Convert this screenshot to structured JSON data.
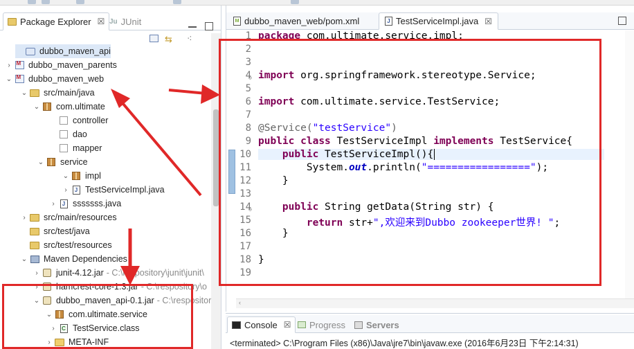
{
  "left_panel": {
    "tabs": [
      {
        "label": "Package Explorer",
        "close": "☒",
        "icon": "package-explorer-icon"
      },
      {
        "label": "JUnit",
        "icon": "junit-icon"
      }
    ],
    "tree": [
      {
        "label": "dubbo_maven_api",
        "icon": "project-icon",
        "toggle": ""
      },
      {
        "label": "dubbo_maven_parents",
        "icon": "maven-project-icon",
        "toggle": "›"
      },
      {
        "label": "dubbo_maven_web",
        "icon": "maven-project-icon",
        "toggle": "⌄"
      },
      {
        "label": "src/main/java",
        "icon": "source-folder-icon",
        "toggle": "⌄"
      },
      {
        "label": "com.ultimate",
        "icon": "package-icon",
        "toggle": "⌄"
      },
      {
        "label": "controller",
        "icon": "empty-package-icon",
        "toggle": ""
      },
      {
        "label": "dao",
        "icon": "empty-package-icon",
        "toggle": ""
      },
      {
        "label": "mapper",
        "icon": "empty-package-icon",
        "toggle": ""
      },
      {
        "label": "service",
        "icon": "package-icon",
        "toggle": "⌄"
      },
      {
        "label": "impl",
        "icon": "package-icon",
        "toggle": "⌄"
      },
      {
        "label": "TestServiceImpl.java",
        "icon": "java-file-icon",
        "toggle": "›"
      },
      {
        "label": "sssssss.java",
        "icon": "java-file-icon",
        "toggle": "›"
      },
      {
        "label": "src/main/resources",
        "icon": "source-folder-icon",
        "toggle": "›"
      },
      {
        "label": "src/test/java",
        "icon": "source-folder-icon",
        "toggle": ""
      },
      {
        "label": "src/test/resources",
        "icon": "source-folder-icon",
        "toggle": ""
      },
      {
        "label": "Maven Dependencies",
        "icon": "library-icon",
        "toggle": "⌄"
      },
      {
        "label": "junit-4.12.jar",
        "icon": "jar-icon",
        "toggle": "›",
        "path": "- C:\\respository\\junit\\junit\\"
      },
      {
        "label": "hamcrest-core-1.3.jar",
        "icon": "jar-icon",
        "toggle": "›",
        "path": "- C:\\respository\\o"
      },
      {
        "label": "dubbo_maven_api-0.1.jar",
        "icon": "jar-icon",
        "toggle": "⌄",
        "path": "- C:\\respositor"
      },
      {
        "label": "com.ultimate.service",
        "icon": "package-icon",
        "toggle": "⌄"
      },
      {
        "label": "TestService.class",
        "icon": "class-file-icon",
        "toggle": "›"
      },
      {
        "label": "META-INF",
        "icon": "folder-icon",
        "toggle": "›"
      }
    ]
  },
  "editor": {
    "tabs": [
      {
        "label": "dubbo_maven_web/pom.xml",
        "icon": "xml-file-icon"
      },
      {
        "label": "TestServiceImpl.java",
        "icon": "java-file-icon",
        "close": "☒"
      }
    ],
    "line_numbers": [
      "1",
      "2",
      "3",
      "4",
      "5",
      "6",
      "7",
      "8",
      "9",
      "10",
      "11",
      "12",
      "13",
      "14",
      "15",
      "16",
      "17",
      "18",
      "19"
    ],
    "code": {
      "l1_kw": "package",
      "l1_rest": " com.ultimate.service.impl;",
      "l4_kw": "import",
      "l4_rest": " org.springframework.stereotype.Service;",
      "l6_kw": "import",
      "l6_rest": " com.ultimate.service.TestService;",
      "l8_ann": "@Service(",
      "l8_str": "\"testService\"",
      "l8_end": ")",
      "l9_kw1": "public",
      "l9_kw2": "class",
      "l9_mid": " TestServiceImpl ",
      "l9_kw3": "implements",
      "l9_end": " TestService{",
      "l10_kw": "public",
      "l10_rest": " TestServiceImpl(){",
      "l11_a": "System.",
      "l11_fld": "out",
      "l11_b": ".println(",
      "l11_str": "\"=================\"",
      "l11_c": ");",
      "l12": "}",
      "l14_kw": "public",
      "l14_rest": " String getData(String str) {",
      "l15_kw": "return",
      "l15_a": " str+",
      "l15_str": "\",欢迎来到Dubbo zookeeper世界! \"",
      "l15_b": ";",
      "l16": "}",
      "l18": "}"
    }
  },
  "console": {
    "tabs": [
      {
        "label": "Console",
        "icon": "console-icon",
        "close": "☒"
      },
      {
        "label": "Progress",
        "icon": "progress-icon"
      },
      {
        "label": "Servers",
        "icon": "servers-icon",
        "close": "☒"
      }
    ],
    "output": "<terminated> C:\\Program Files (x86)\\Java\\jre7\\bin\\javaw.exe (2016年6月23日 下午2:14:31)"
  },
  "colors": {
    "annotation_red": "#e02828",
    "keyword": "#7f0055",
    "string": "#2a00ff",
    "selection": "#dce8f7"
  }
}
